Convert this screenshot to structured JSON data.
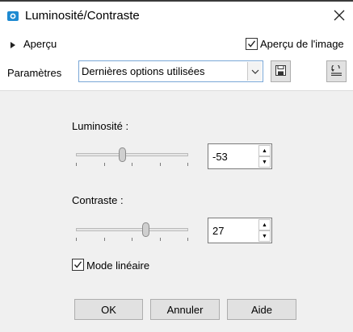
{
  "window": {
    "title": "Luminosité/Contraste",
    "icon": "app-camera-icon",
    "close_icon": "close-icon"
  },
  "preview": {
    "expander_label": "Aperçu",
    "image_preview_label": "Aperçu de l'image",
    "image_preview_checked": true
  },
  "settings": {
    "label": "Paramètres",
    "preset_value": "Dernières options utilisées",
    "save_icon": "save-icon",
    "reset_icon": "reset-icon"
  },
  "brightness": {
    "label": "Luminosité :",
    "value": "-53",
    "slider_fraction": 0.41,
    "ticks": 5
  },
  "contrast": {
    "label": "Contraste :",
    "value": "27",
    "slider_fraction": 0.63,
    "ticks": 5
  },
  "linear_mode": {
    "label": "Mode linéaire",
    "checked": true
  },
  "buttons": {
    "ok": "OK",
    "cancel": "Annuler",
    "help": "Aide"
  },
  "colors": {
    "app_icon": "#1e8ad1",
    "combo_border": "#7aa7d6"
  }
}
